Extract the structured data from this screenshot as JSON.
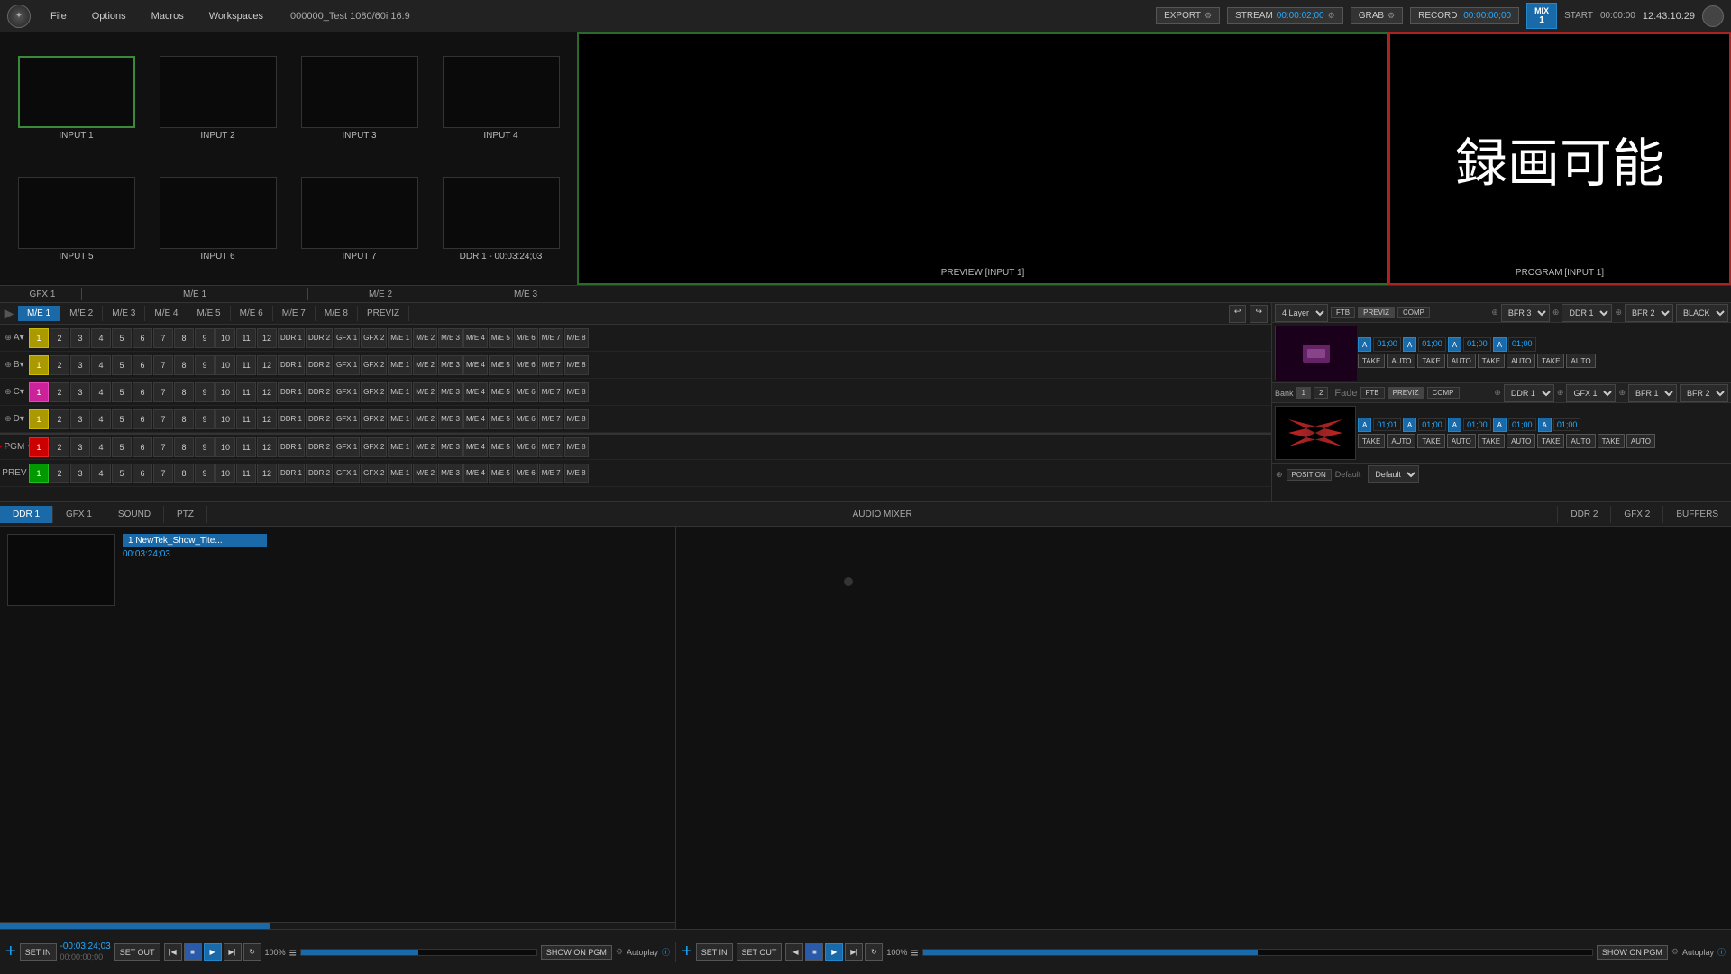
{
  "topbar": {
    "logo": "✦",
    "menu": [
      "File",
      "Options",
      "Macros",
      "Workspaces"
    ],
    "project": "000000_Test  1080/60i 16:9",
    "export_label": "EXPORT",
    "stream_label": "STREAM",
    "stream_time": "00:00:02;00",
    "grab_label": "GRAB",
    "record_label": "RECORD",
    "record_time": "00:00:00;00",
    "mix_label": "MIX",
    "mix_num": "1",
    "start_label": "START",
    "start_time": "00:00:00",
    "clock": "12:43:10:29"
  },
  "preview_monitor": {
    "label": "PREVIEW [INPUT 1]",
    "inputs": [
      {
        "label": "INPUT 1",
        "active": true
      },
      {
        "label": "INPUT 2",
        "active": false
      },
      {
        "label": "INPUT 3",
        "active": false
      },
      {
        "label": "INPUT 4",
        "active": false
      },
      {
        "label": "INPUT 5",
        "active": false
      },
      {
        "label": "INPUT 6",
        "active": false
      },
      {
        "label": "INPUT 7",
        "active": false
      },
      {
        "label": "DDR 1 - 00:03:24;03",
        "active": false
      }
    ]
  },
  "program_monitor": {
    "label": "PROGRAM [INPUT 1]",
    "kanji": "録画可能"
  },
  "section_labels": {
    "gfx1": "GFX 1",
    "me1": "M/E 1",
    "me2": "M/E 2",
    "me3": "M/E 3"
  },
  "switcher_tabs": {
    "tabs": [
      "M/E 1",
      "M/E 2",
      "M/E 3",
      "M/E 4",
      "M/E 5",
      "M/E 6",
      "M/E 7",
      "M/E 8",
      "PREVIZ"
    ]
  },
  "bus_rows": {
    "rows": [
      {
        "label": "A▾",
        "active_cell": 1,
        "active_type": "yellow"
      },
      {
        "label": "B▾",
        "active_cell": 1,
        "active_type": "yellow"
      },
      {
        "label": "C▾",
        "active_cell": 1,
        "active_type": "pink"
      },
      {
        "label": "D▾",
        "active_cell": 1,
        "active_type": "yellow"
      }
    ],
    "cells": [
      "1",
      "2",
      "3",
      "4",
      "5",
      "6",
      "7",
      "8",
      "9",
      "10",
      "11",
      "12",
      "DDR 1",
      "DDR 2",
      "GFX 1",
      "GFX 2",
      "M/E 1",
      "M/E 2",
      "M/E 3",
      "M/E 4",
      "M/E 5",
      "M/E 6",
      "M/E 7",
      "M/E 8"
    ]
  },
  "pgm_row": {
    "label": "PGM",
    "active_cell": 1,
    "cells": [
      "1",
      "2",
      "3",
      "4",
      "5",
      "6",
      "7",
      "8",
      "9",
      "10",
      "11",
      "12",
      "DDR 1",
      "DDR 2",
      "GFX 1",
      "GFX 2",
      "M/E 1",
      "M/E 2",
      "M/E 3",
      "M/E 4",
      "M/E 5",
      "M/E 6",
      "M/E 7",
      "M/E 8"
    ]
  },
  "prev_row": {
    "label": "PREV",
    "active_cell": 1,
    "cells": [
      "1",
      "2",
      "3",
      "4",
      "5",
      "6",
      "7",
      "8",
      "9",
      "10",
      "11",
      "12",
      "DDR 1",
      "DDR 2",
      "GFX 1",
      "GFX 2",
      "M/E 1",
      "M/E 2",
      "M/E 3",
      "M/E 4",
      "M/E 5",
      "M/E 6",
      "M/E 7",
      "M/E 8"
    ]
  },
  "right_panel": {
    "top": {
      "layer_label": "4 Layer",
      "ftb_label": "FTB",
      "previz_label": "PREVIZ",
      "comp_label": "COMP",
      "bfr3_label": "BFR 3",
      "ddr1_label": "DDR 1",
      "bfr2_label": "BFR 2",
      "black_label": "BLACK"
    },
    "row1": {
      "take": "TAKE",
      "auto": "AUTO",
      "val1": "01;00",
      "val2": "01;00",
      "val3": "01;00",
      "val4": "01;00"
    },
    "row2": {
      "fade_label": "Fade",
      "ftb_label": "FTB",
      "previz_label": "PREVIZ",
      "comp_label": "COMP",
      "ddr1_label": "DDR 1",
      "gfx1_label": "GFX 1",
      "bfr1_label": "BFR 1",
      "bfr2_label": "BFR 2"
    },
    "row2_controls": {
      "a_val": "01;01",
      "take": "TAKE",
      "auto": "AUTO",
      "val1": "01;00",
      "val2": "01;00",
      "val3": "01;00",
      "val4": "01;00"
    },
    "bank": "1",
    "position_label": "POSITION",
    "default_label": "Default"
  },
  "bottom_tabs": {
    "left": [
      "DDR 1",
      "GFX 1",
      "SOUND",
      "PTZ"
    ],
    "center_label": "AUDIO MIXER",
    "right": [
      "DDR 2",
      "GFX 2",
      "BUFFERS"
    ]
  },
  "ddr": {
    "clip_name": "1 NewTek_Show_Tite...",
    "clip_time": "00:03:24;03",
    "time_display": "-00:03:24;03\n00:00:00;00"
  },
  "transport_left": {
    "plus": "+",
    "set_in": "SET IN",
    "timecode1": "-00:03:24;03",
    "timecode2": "00:00:00;00",
    "set_out": "SET OUT",
    "zoom": "100%",
    "show_pgm": "SHOW ON PGM",
    "autoplay": "Autoplay"
  },
  "transport_right": {
    "plus": "+",
    "set_in": "SET IN",
    "set_out": "SET OUT",
    "zoom": "100%",
    "show_pgm": "SHOW ON PGM",
    "autoplay": "Autoplay"
  }
}
